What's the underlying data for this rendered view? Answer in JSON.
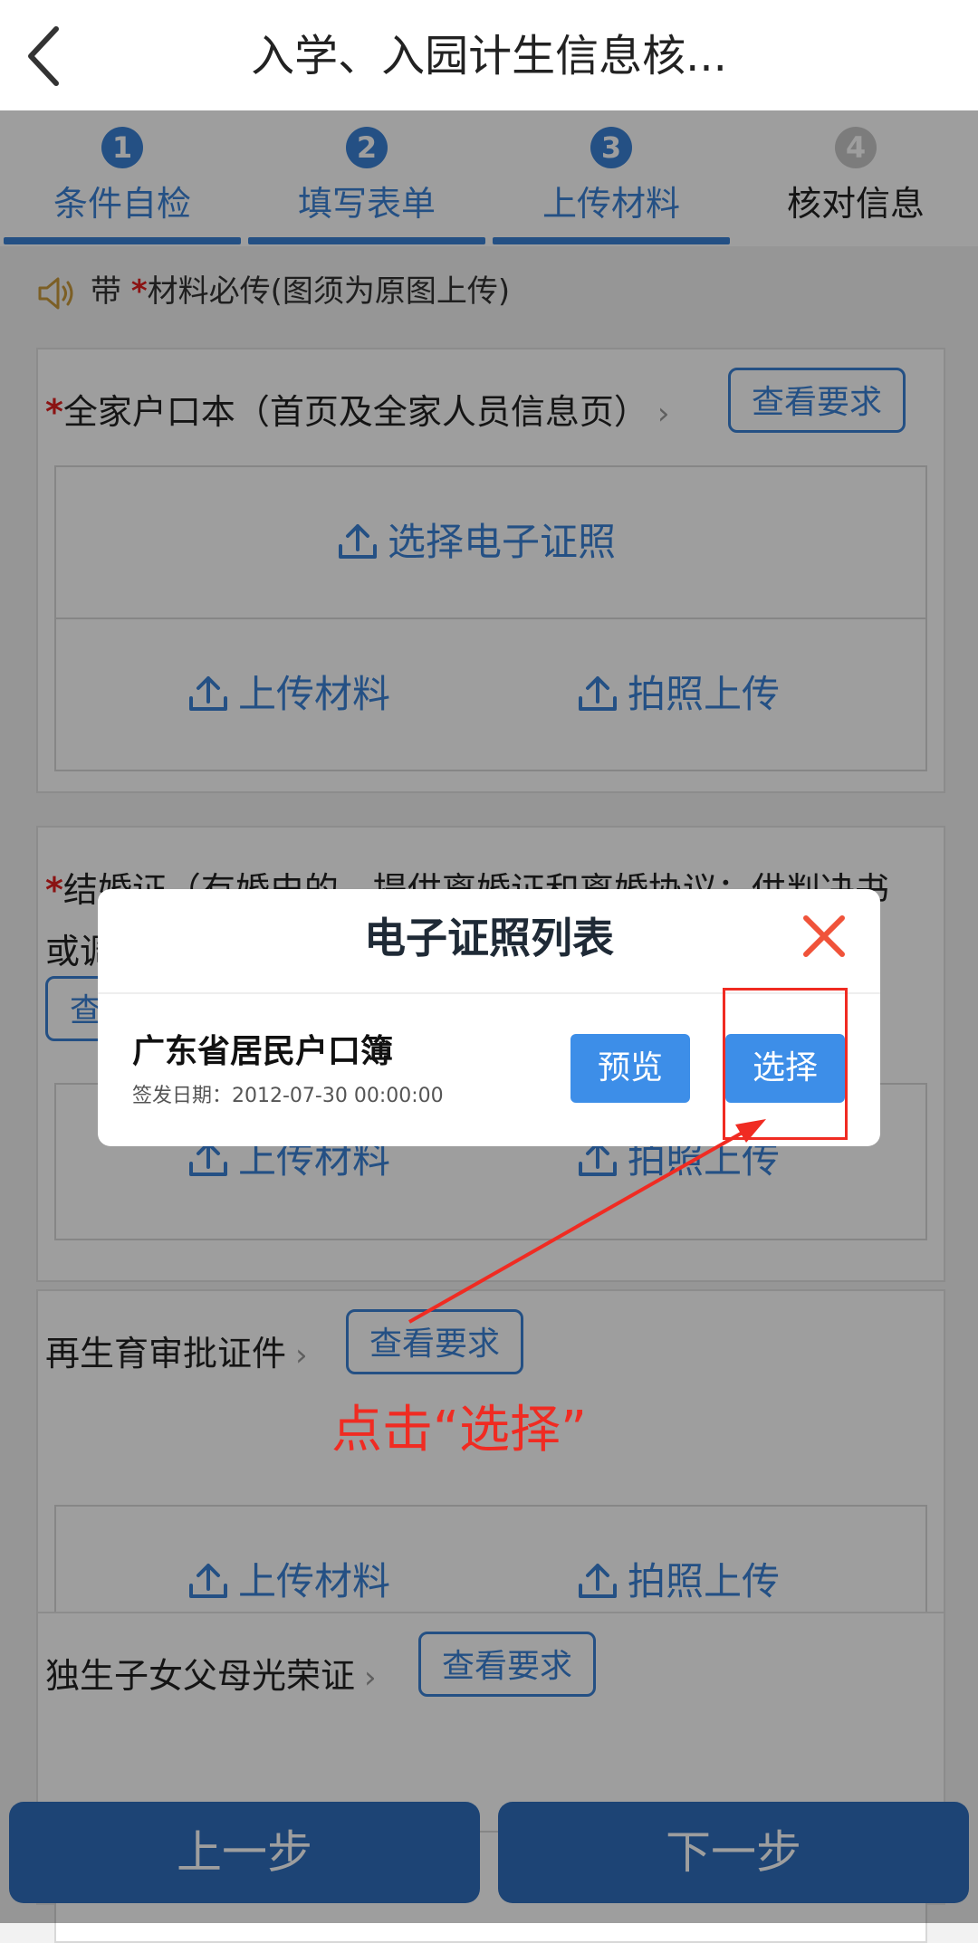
{
  "header": {
    "title": "入学、入园计生信息核..."
  },
  "steps": [
    {
      "num": "1",
      "label": "条件自检"
    },
    {
      "num": "2",
      "label": "填写表单"
    },
    {
      "num": "3",
      "label": "上传材料"
    },
    {
      "num": "4",
      "label": "核对信息"
    }
  ],
  "notice": {
    "prefix": "带",
    "star": "*",
    "text": "材料必传(图须为原图上传)"
  },
  "cards": [
    {
      "star": "*",
      "title": "全家户口本（首页及全家人员信息页）",
      "chevron": "›",
      "req_btn": "查看要求",
      "e_cert": "选择电子证照",
      "upload": "上传材料",
      "photo": "拍照上传"
    },
    {
      "star": "*",
      "title": "结婚证（有婚史的，提供离婚证和离婚协议；供判决书",
      "title2": "或调",
      "req_btn": "查",
      "upload": "上传材料",
      "photo": "拍照上传"
    },
    {
      "title": "再生育审批证件",
      "chevron": "›",
      "req_btn": "查看要求",
      "upload": "上传材料",
      "photo": "拍照上传"
    },
    {
      "title": "独生子女父母光荣证",
      "chevron": "›",
      "req_btn": "查看要求"
    }
  ],
  "bottom": {
    "prev": "上一步",
    "next": "下一步"
  },
  "modal": {
    "title": "电子证照列表",
    "cert_name": "广东省居民户口簿",
    "cert_date": "签发日期：2012-07-30 00:00:00",
    "preview": "预览",
    "select": "选择"
  },
  "annotation": {
    "text": "点击“选择”"
  },
  "colors": {
    "accent": "#3b82d6",
    "highlight": "#f02b22"
  }
}
